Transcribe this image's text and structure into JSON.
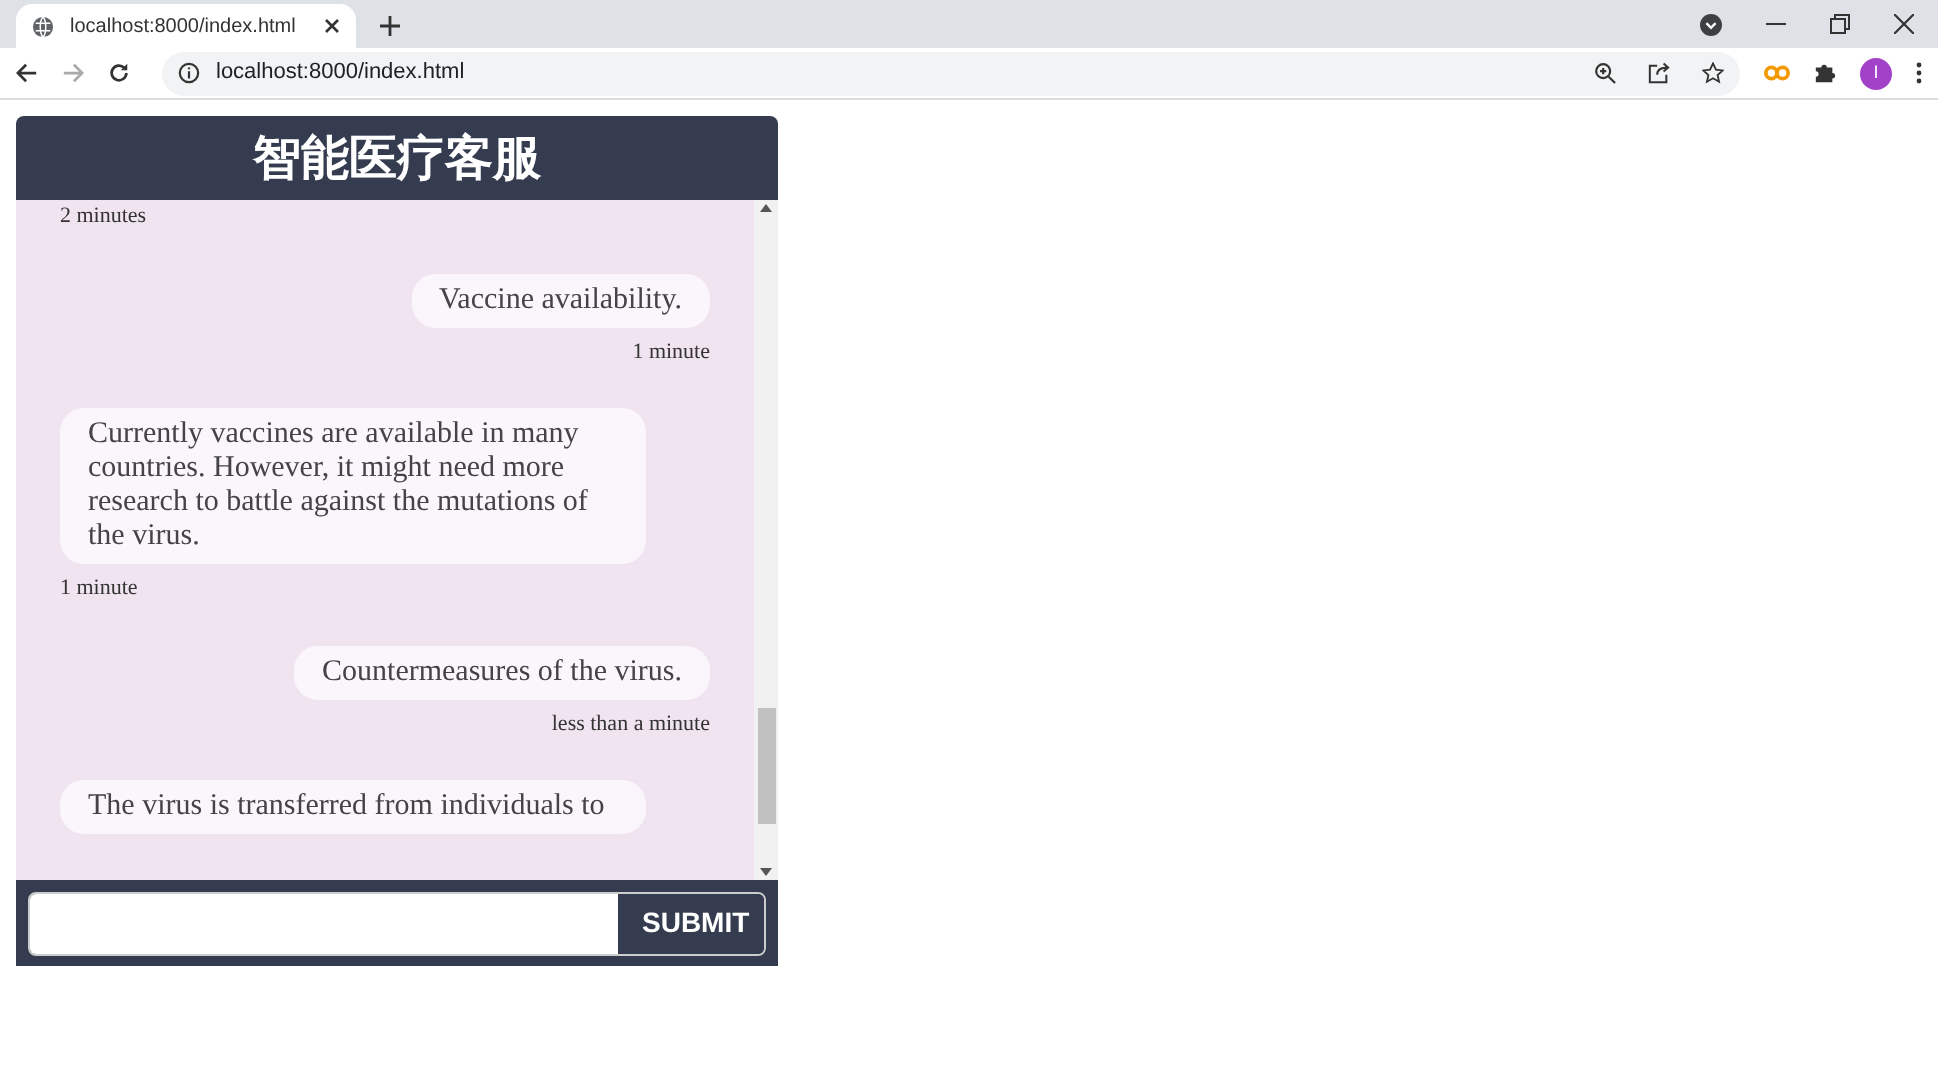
{
  "browser": {
    "tab_title": "localhost:8000/index.html",
    "address": "localhost:8000/index.html",
    "profile_initial": "I"
  },
  "chat": {
    "title": "智能医疗客服",
    "messages": [
      {
        "kind": "bot",
        "time": "2 minutes"
      },
      {
        "kind": "user",
        "text": "Vaccine availability.",
        "time": "1 minute"
      },
      {
        "kind": "bot",
        "text": "Currently vaccines are available in many countries. However, it might need more research to battle against the mutations of the virus.",
        "time": "1 minute"
      },
      {
        "kind": "user",
        "text": "Countermeasures of the virus.",
        "time": "less than a minute"
      },
      {
        "kind": "bot",
        "text": "The virus is transferred from individuals to"
      }
    ],
    "submit_label": "SUBMIT"
  }
}
